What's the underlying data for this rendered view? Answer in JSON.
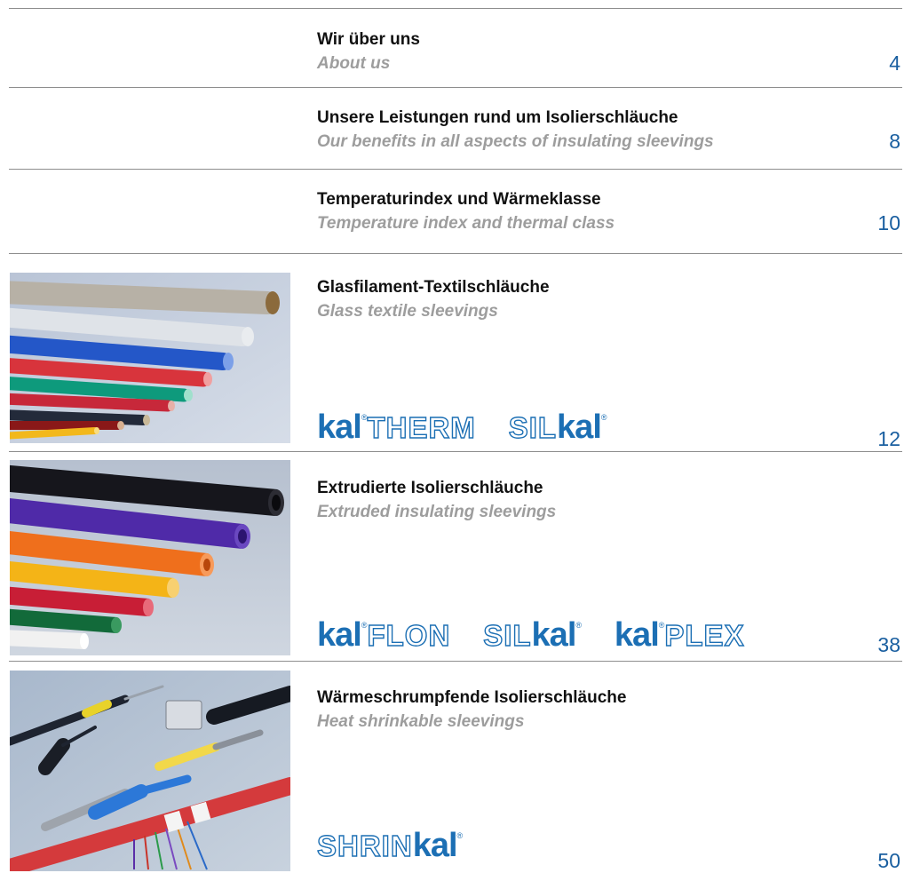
{
  "entries": [
    {
      "title": "Wir über uns",
      "subtitle": "About us",
      "page": "4"
    },
    {
      "title": "Unsere Leistungen rund um Isolierschläuche",
      "subtitle": "Our benefits in all aspects of insulating sleevings",
      "page": "8"
    },
    {
      "title": "Temperaturindex und Wärmeklasse",
      "subtitle": "Temperature index and thermal class",
      "page": "10"
    },
    {
      "title": "Glasfilament-Textilschläuche",
      "subtitle": "Glass textile sleevings",
      "page": "12",
      "logos": [
        [
          "kal",
          "THERM"
        ],
        [
          "SIL",
          "kal"
        ]
      ]
    },
    {
      "title": "Extrudierte Isolierschläuche",
      "subtitle": "Extruded insulating sleevings",
      "page": "38",
      "logos": [
        [
          "kal",
          "FLON"
        ],
        [
          "SIL",
          "kal"
        ],
        [
          "kal",
          "PLEX"
        ]
      ]
    },
    {
      "title": "Wärmeschrumpfende Isolierschläuche",
      "subtitle": "Heat shrinkable sleevings",
      "page": "50",
      "logos": [
        [
          "SHRIN",
          "kal"
        ]
      ]
    }
  ],
  "colors": {
    "accent": "#1c6fb4",
    "page_number": "#1a5fa0",
    "subtitle": "#9d9d9d",
    "rule": "#8e8e8e"
  }
}
